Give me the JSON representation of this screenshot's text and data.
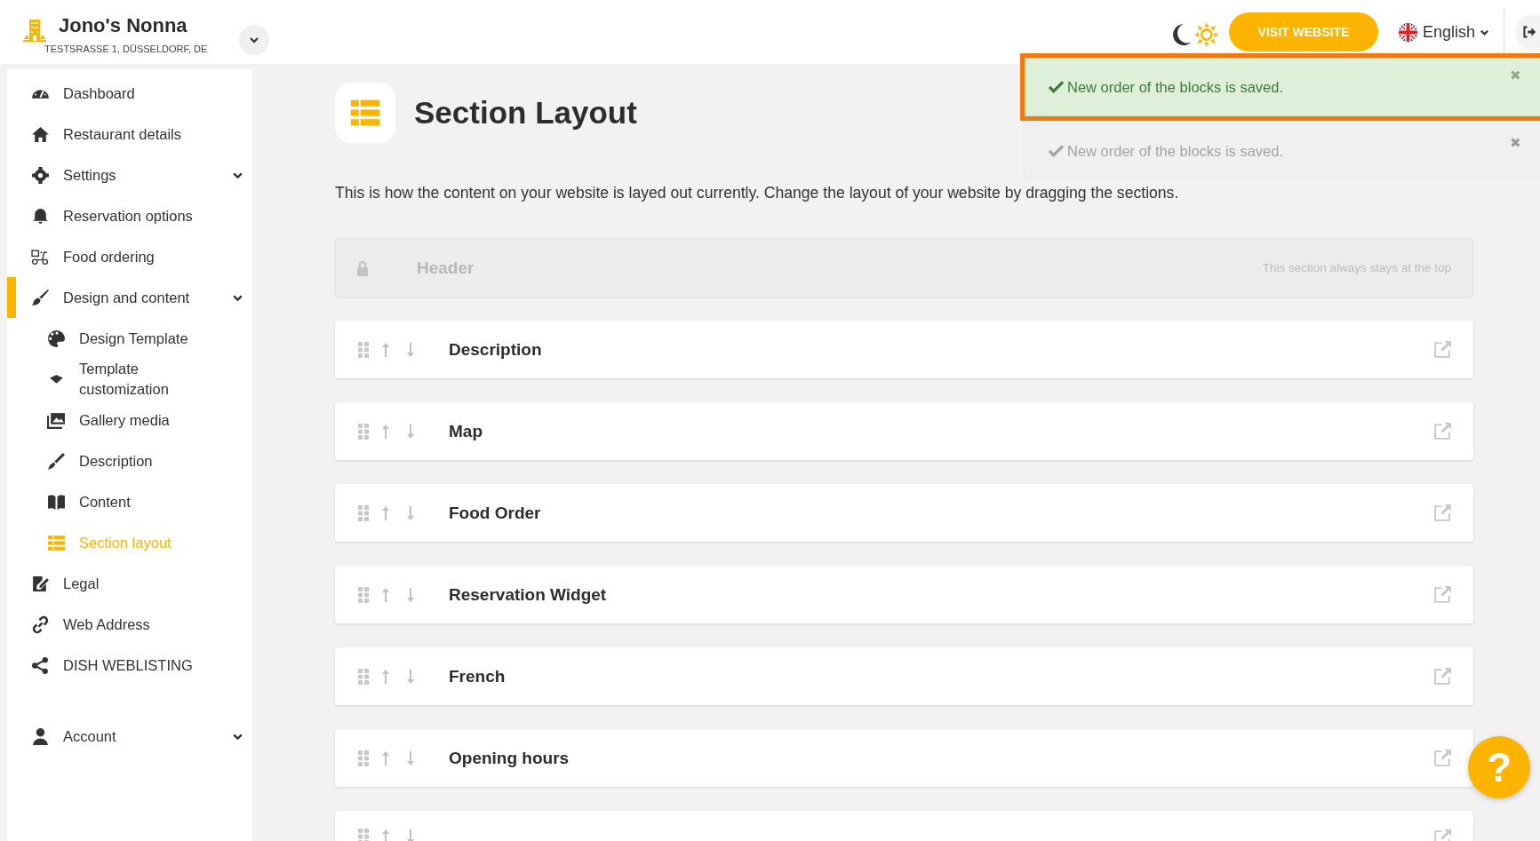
{
  "brand": {
    "name": "Jono's Nonna",
    "address": "TESTSRASSE 1, DÜSSELDORF, DE"
  },
  "topbar": {
    "visit_button": "VISIT WEBSITE",
    "language": "English"
  },
  "toasts": [
    {
      "message": "New order of the blocks is saved.",
      "close": "✖",
      "highlighted": true,
      "faded": false
    },
    {
      "message": "New order of the blocks is saved.",
      "close": "✖",
      "highlighted": false,
      "faded": true
    }
  ],
  "sidebar": {
    "items": [
      {
        "label": "Dashboard",
        "selected": false,
        "active": false,
        "has_submenu": false
      },
      {
        "label": "Restaurant details",
        "selected": false,
        "active": false,
        "has_submenu": false
      },
      {
        "label": "Settings",
        "selected": false,
        "active": false,
        "has_submenu": true
      },
      {
        "label": "Reservation options",
        "selected": false,
        "active": false,
        "has_submenu": false
      },
      {
        "label": "Food ordering",
        "selected": false,
        "active": false,
        "has_submenu": false
      },
      {
        "label": "Design and content",
        "selected": false,
        "active": true,
        "has_submenu": true,
        "children": [
          {
            "label": "Design Template",
            "selected": false
          },
          {
            "label": "Template customization",
            "selected": false
          },
          {
            "label": "Gallery media",
            "selected": false
          },
          {
            "label": "Description",
            "selected": false
          },
          {
            "label": "Content",
            "selected": false
          },
          {
            "label": "Section layout",
            "selected": true
          }
        ]
      },
      {
        "label": "Legal",
        "selected": false,
        "active": false,
        "has_submenu": false
      },
      {
        "label": "Web Address",
        "selected": false,
        "active": false,
        "has_submenu": false
      },
      {
        "label": "DISH WEBLISTING",
        "selected": false,
        "active": false,
        "has_submenu": false
      }
    ],
    "account": {
      "label": "Account",
      "selected": false,
      "has_submenu": true
    }
  },
  "page": {
    "title": "Section Layout",
    "description": "This is how the content on your website is layed out currently. Change the layout of your website by dragging the sections."
  },
  "sections": [
    {
      "kind": "locked",
      "name": "Header",
      "note": "This section always stays at the top"
    },
    {
      "kind": "movable",
      "name": "Description"
    },
    {
      "kind": "movable",
      "name": "Map"
    },
    {
      "kind": "movable",
      "name": "Food Order"
    },
    {
      "kind": "movable",
      "name": "Reservation Widget"
    },
    {
      "kind": "movable",
      "name": "French"
    },
    {
      "kind": "movable",
      "name": "Opening hours"
    },
    {
      "kind": "cut_off"
    }
  ],
  "help_button": "?"
}
